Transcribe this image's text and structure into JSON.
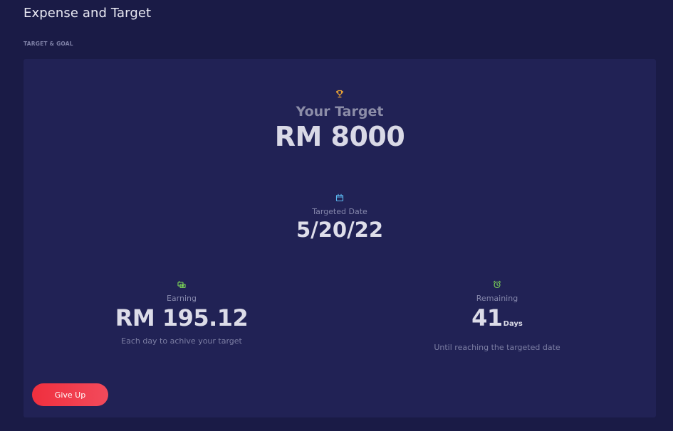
{
  "header": {
    "title": "Expense and Target"
  },
  "section": {
    "label": "TARGET & GOAL"
  },
  "target": {
    "icon": "trophy-icon",
    "heading": "Your Target",
    "amount": "RM 8000"
  },
  "targeted_date": {
    "icon": "calendar-icon",
    "label": "Targeted Date",
    "value": "5/20/22"
  },
  "earning": {
    "icon": "money-icon",
    "label": "Earning",
    "value": "RM 195.12",
    "caption": "Each day to achive your target"
  },
  "remaining": {
    "icon": "alarm-clock-icon",
    "label": "Remaining",
    "value": "41",
    "unit": "Days",
    "caption": "Until reaching the targeted date"
  },
  "actions": {
    "give_up_label": "Give Up"
  },
  "colors": {
    "page_background": "#1a1b46",
    "card_background": "#212255",
    "trophy_icon": "#e8a235",
    "calendar_icon": "#5bb8f0",
    "green_icon": "#7ed957",
    "button_red": "#ef2f3e"
  }
}
